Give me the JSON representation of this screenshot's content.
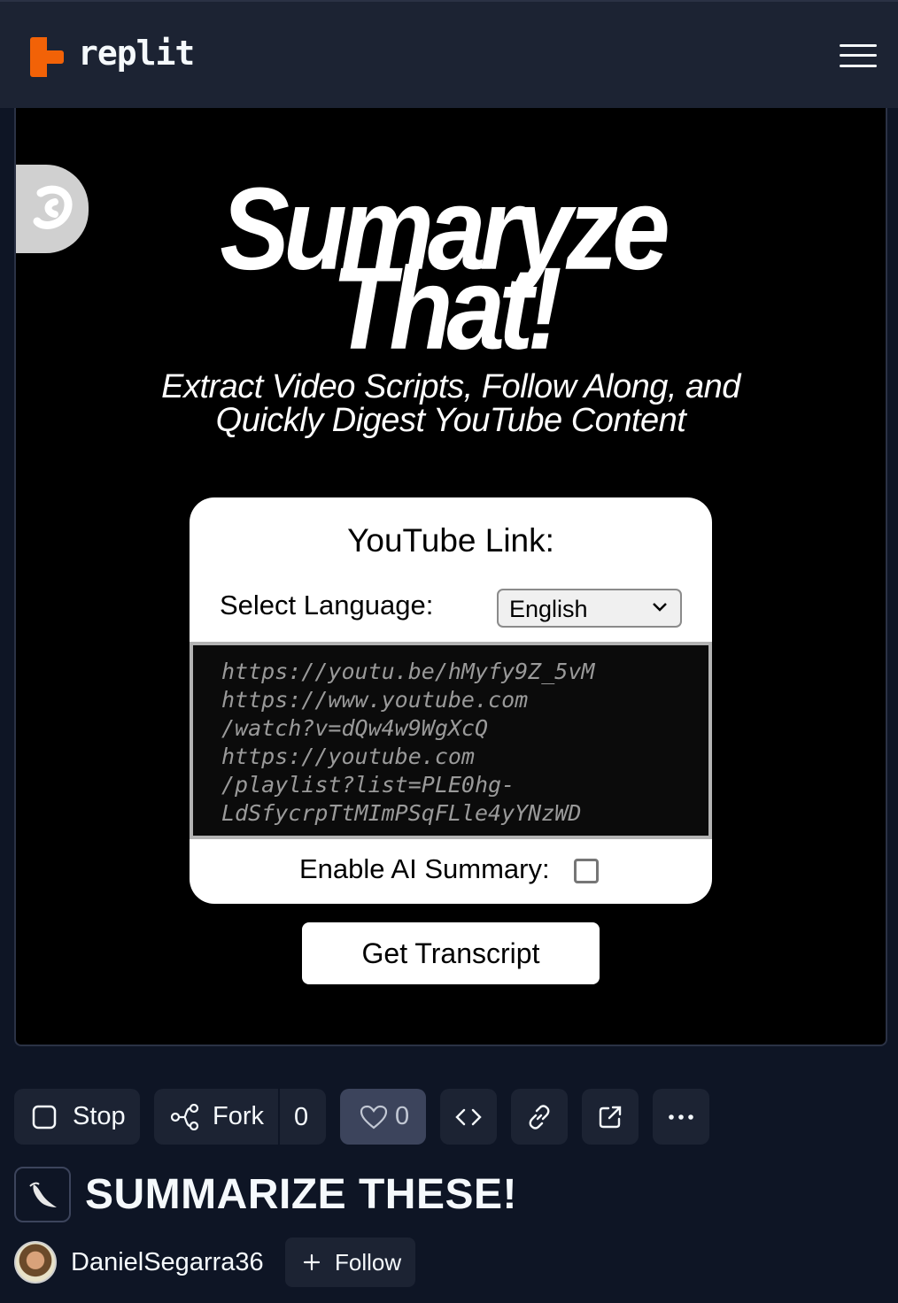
{
  "header": {
    "brand": "replit",
    "menu_icon": "hamburger-menu-icon"
  },
  "app": {
    "side_tab_icon": "replit-badge-icon",
    "title_line1": "Sumaryze",
    "title_line2": "That!",
    "subtitle_line1": "Extract Video Scripts, Follow Along, and",
    "subtitle_line2": "Quickly Digest YouTube Content",
    "card": {
      "heading": "YouTube Link:",
      "language_label": "Select Language:",
      "language_selected": "English",
      "url_placeholder": "https://youtu.be/hMyfy9Z_5vM\nhttps://www.youtube.com\n/watch?v=dQw4w9WgXcQ\nhttps://youtube.com\n/playlist?list=PLE0hg-\nLdSfycrpTtMImPSqFLle4yYNzWD",
      "ai_summary_label": "Enable AI Summary:",
      "ai_summary_checked": false
    },
    "submit_label": "Get Transcript"
  },
  "actions": {
    "stop_label": "Stop",
    "fork_label": "Fork",
    "fork_count": "0",
    "like_count": "0",
    "code_icon": "code-icon",
    "link_icon": "link-icon",
    "open_icon": "external-link-icon",
    "more_icon": "more-icon"
  },
  "repl": {
    "icon": "flask-icon",
    "title": "SUMMARIZE THESE!",
    "author": "DanielSegarra36",
    "follow_label": "Follow"
  },
  "colors": {
    "page_bg": "#0e1525",
    "header_bg": "#1c2333",
    "brand_orange": "#f26207",
    "like_active_bg": "#3c445c"
  }
}
